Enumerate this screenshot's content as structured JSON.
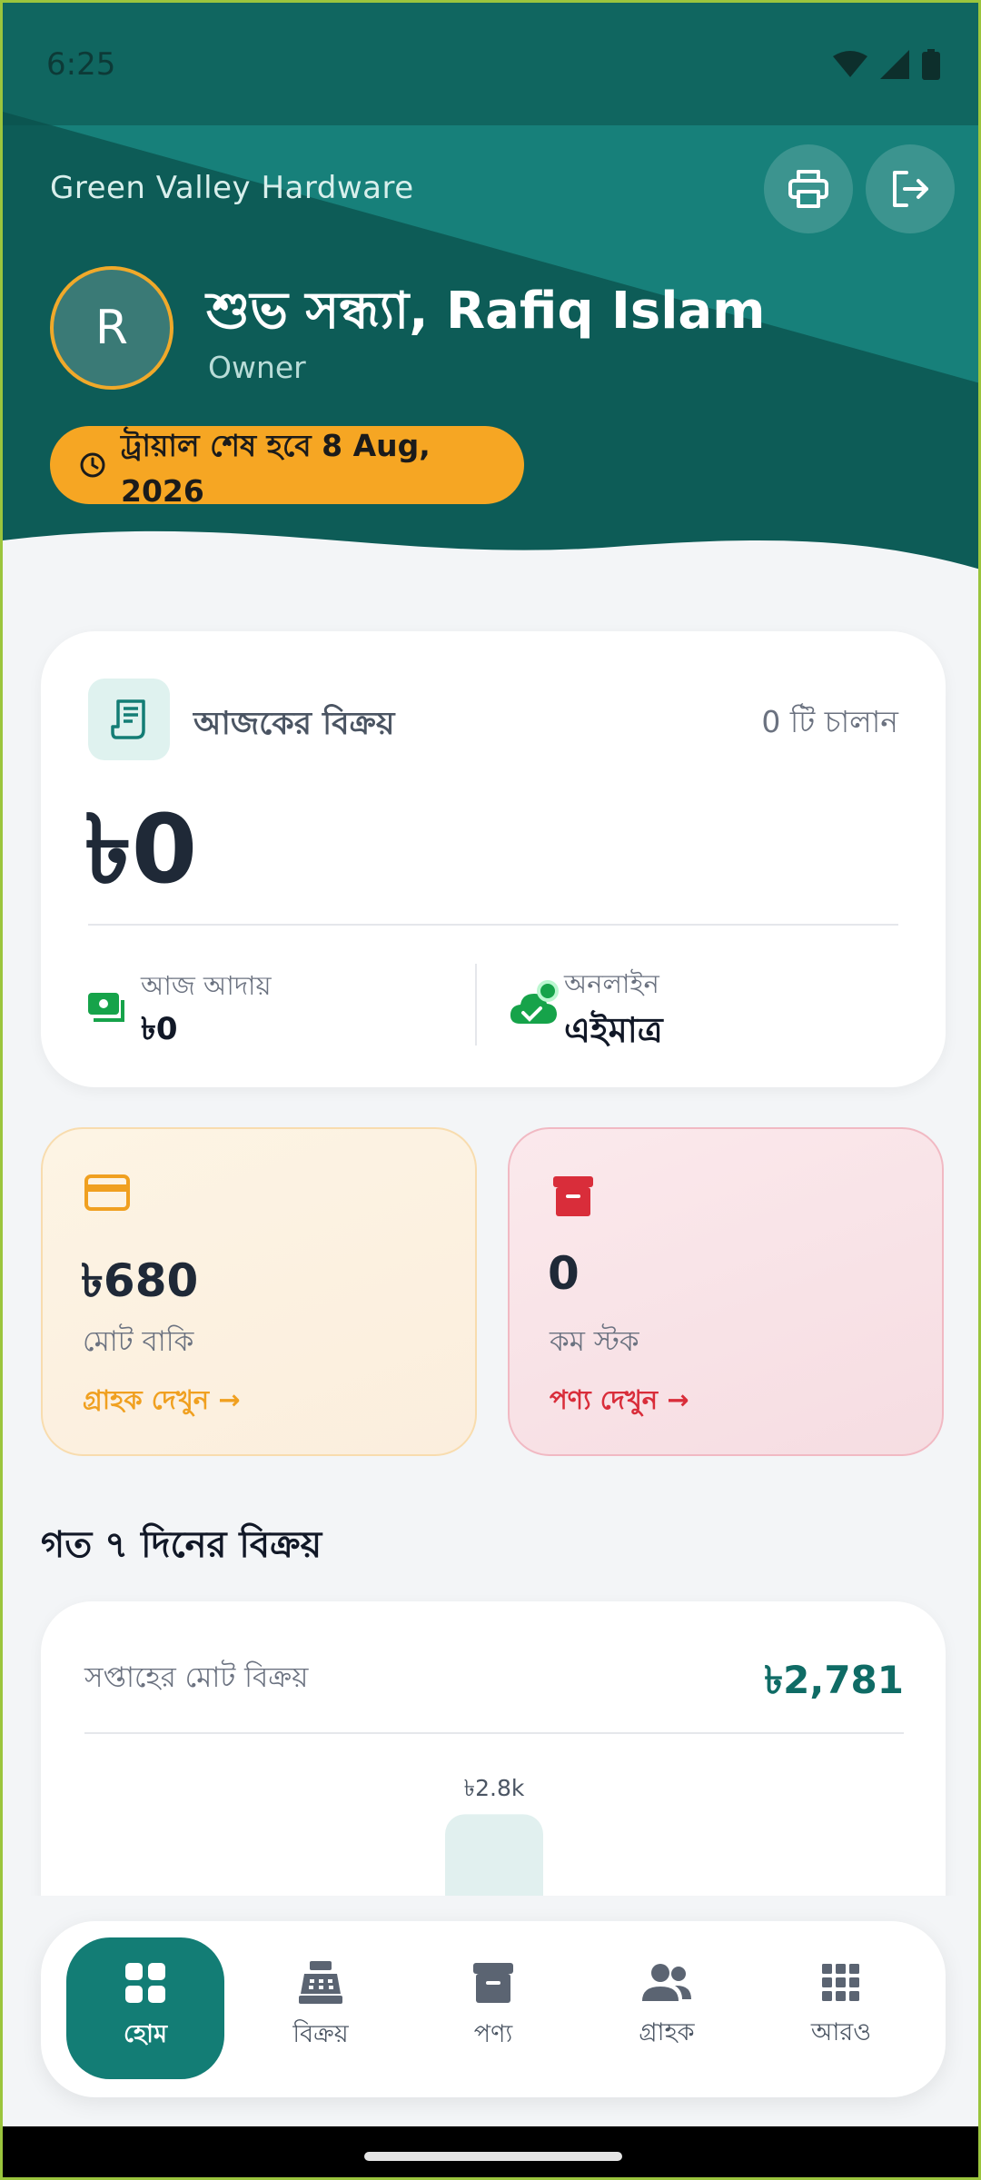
{
  "status_bar": {
    "time": "6:25"
  },
  "header": {
    "store_name": "Green Valley Hardware",
    "avatar_initial": "R",
    "greeting": "শুভ সন্ধ্যা, Rafiq Islam",
    "role": "Owner",
    "trial_text": "ট্রায়াল শেষ হবে 8 Aug, 2026"
  },
  "today_sales": {
    "title": "আজকের বিক্রয়",
    "invoice_count": "0 টি চালান",
    "amount": "৳0",
    "collected_label": "আজ আদায়",
    "collected_value": "৳0",
    "online_label": "অনলাইন",
    "online_value": "এইমাত্র"
  },
  "stats": {
    "due": {
      "value": "৳680",
      "label": "মোট বাকি",
      "link": "গ্রাহক দেখুন"
    },
    "low_stock": {
      "value": "0",
      "label": "কম স্টক",
      "link": "পণ্য দেখুন"
    }
  },
  "weekly": {
    "section_title": "গত ৭ দিনের বিক্রয়",
    "total_label": "সপ্তাহের মোট বিক্রয়",
    "total_value": "৳2,781"
  },
  "chart_data": {
    "type": "bar",
    "bar_label": "৳2.8k",
    "value": 2781
  },
  "nav": [
    {
      "label": "হোম",
      "icon": "dashboard-icon",
      "active": true
    },
    {
      "label": "বিক্রয়",
      "icon": "cash-register-icon",
      "active": false
    },
    {
      "label": "পণ্য",
      "icon": "archive-box-icon",
      "active": false
    },
    {
      "label": "গ্রাহক",
      "icon": "people-icon",
      "active": false
    },
    {
      "label": "আরও",
      "icon": "apps-grid-icon",
      "active": false
    }
  ],
  "colors": {
    "primary": "#137d75",
    "header_dark": "#0f5f5a",
    "accent": "#f6a623",
    "danger": "#d92d3a"
  }
}
